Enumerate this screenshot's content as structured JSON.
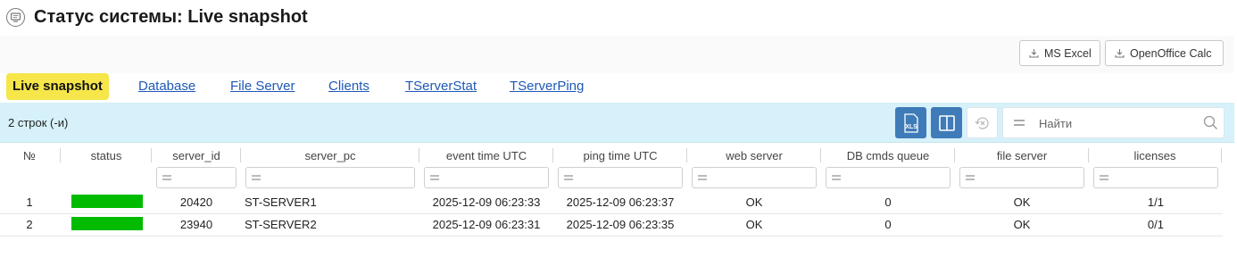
{
  "page": {
    "title": "Статус системы: Live snapshot"
  },
  "export": {
    "excel_label": "MS Excel",
    "calc_label": "OpenOffice Calc"
  },
  "tabs": [
    "Live snapshot",
    "Database",
    "File Server",
    "Clients",
    "TServerStat",
    "TServerPing"
  ],
  "toolbar": {
    "rows_count": "2 строк (-и)",
    "xls_label": "XLS",
    "search_placeholder": "Найти"
  },
  "table": {
    "columns": [
      "№",
      "status",
      "server_id",
      "server_pc",
      "event time UTC",
      "ping time UTC",
      "web server",
      "DB cmds queue",
      "file server",
      "licenses"
    ],
    "rows": [
      {
        "num": "1",
        "status_color": "#00bb00",
        "server_id": "20420",
        "server_pc": "ST-SERVER1",
        "event_time": "2025-12-09 06:23:33",
        "ping_time": "2025-12-09 06:23:37",
        "web_server": "OK",
        "db_queue": "0",
        "file_server": "OK",
        "licenses": "1/1"
      },
      {
        "num": "2",
        "status_color": "#00bb00",
        "server_id": "23940",
        "server_pc": "ST-SERVER2",
        "event_time": "2025-12-09 06:23:31",
        "ping_time": "2025-12-09 06:23:35",
        "web_server": "OK",
        "db_queue": "0",
        "file_server": "OK",
        "licenses": "0/1"
      }
    ]
  },
  "colors": {
    "accent_blue": "#3e7bb8",
    "toolbar_bg": "#d6f1fa",
    "active_tab": "#f6e64a",
    "link": "#1f58b6"
  }
}
